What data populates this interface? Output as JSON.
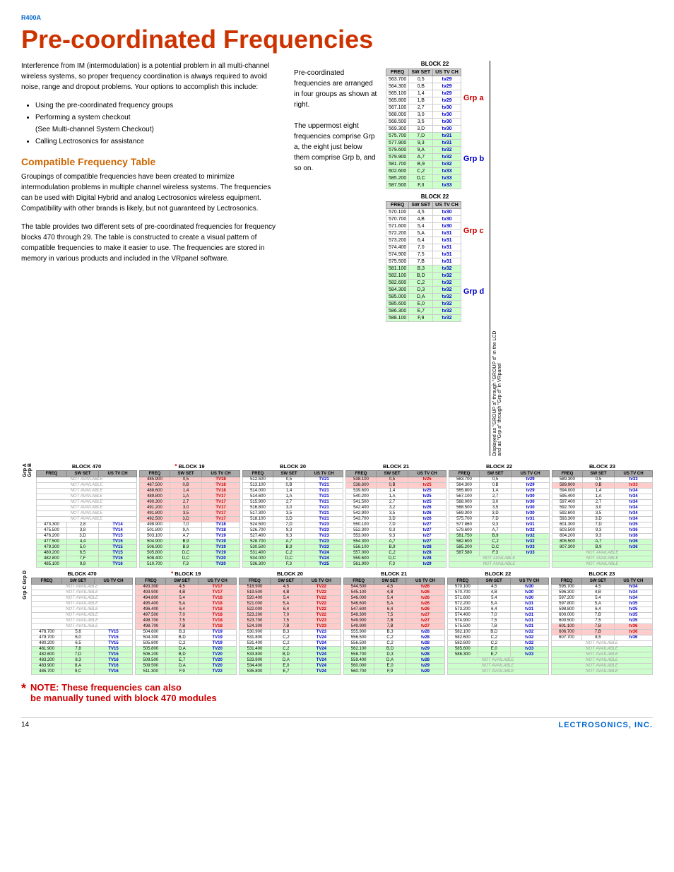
{
  "header": {
    "model": "R400A"
  },
  "title": "Pre-coordinated Frequencies",
  "intro": "Interference from IM (intermodulation) is a potential problem in all multi-channel wireless systems, so proper frequency coordination is always required to avoid noise, range and dropout problems. Your options to accomplish this include:",
  "bullets": [
    "Using the pre-coordinated frequency groups",
    "Performing a system checkout (See Multi-channel System Checkout)",
    "Calling Lectrosonics for assistance"
  ],
  "section_title": "Compatible Frequency Table",
  "body1": "Groupings of compatible frequencies have been created to minimize intermodulation problems in multiple channel wireless systems. The frequencies can be used with Digital Hybrid and analog Lectrosonics wireless equipment. Compatibility with other brands is likely, but not guaranteed by Lectrosonics.",
  "body2": "The table provides two different sets of pre-coordinated frequencies for frequency blocks 470 through 29. The table is constructed to create a visual pattern of compatible frequencies to make it easier to use. The frequencies are stored in memory in various products and included in the VRpanel software.",
  "mid_text1": "Pre-coordinated frequencies are arranged in four groups as shown at right.",
  "mid_text2": "The uppermost eight frequencies comprise Grp a, the eight just below them comprise Grp b, and so on.",
  "note": "NOTE:  These frequencies can also be manually tuned with block 470 modules",
  "footer": {
    "page": "14",
    "brand": "LECTROSONICS, INC."
  },
  "block22_top": {
    "title": "BLOCK 22",
    "headers": [
      "FREQ",
      "SW SET",
      "US TV CH"
    ],
    "rows": [
      [
        "563.700",
        "0,5",
        "tv29"
      ],
      [
        "564.300",
        "0,B",
        "tv29"
      ],
      [
        "565.100",
        "1,4",
        "tv29"
      ],
      [
        "565.800",
        "1,B",
        "tv29"
      ],
      [
        "567.100",
        "2,7",
        "tv30"
      ],
      [
        "568.000",
        "3,0",
        "tv30"
      ],
      [
        "568.500",
        "3,5",
        "tv30"
      ],
      [
        "569.300",
        "3,D",
        "tv30"
      ],
      [
        "575.700",
        "7,D",
        "tv31"
      ],
      [
        "577.900",
        "9,3",
        "tv31"
      ],
      [
        "579.600",
        "9,A",
        "tv32"
      ],
      [
        "579.900",
        "A,7",
        "tv32"
      ],
      [
        "581.700",
        "B,9",
        "tv32"
      ],
      [
        "602.600",
        "C,2",
        "tv33"
      ],
      [
        "585.200",
        "D,C",
        "tv33"
      ],
      [
        "587.500",
        "F,3",
        "tv33"
      ]
    ],
    "grp_a_rows": [
      0,
      7
    ],
    "grp_b_rows": [
      8,
      15
    ]
  },
  "block22_bottom": {
    "title": "BLOCK 22",
    "headers": [
      "FREQ",
      "SW SET",
      "US TV CH"
    ],
    "rows": [
      [
        "570.100",
        "4,5",
        "tv30"
      ],
      [
        "570.700",
        "4,B",
        "tv30"
      ],
      [
        "571.600",
        "5,4",
        "tv30"
      ],
      [
        "572.200",
        "5,A",
        "tv31"
      ],
      [
        "573.200",
        "6,4",
        "tv31"
      ],
      [
        "574.400",
        "7,0",
        "tv31"
      ],
      [
        "574.900",
        "7,5",
        "tv31"
      ],
      [
        "575.500",
        "7,B",
        "tv31"
      ],
      [
        "581.100",
        "B,3",
        "tv32"
      ],
      [
        "582.100",
        "B,D",
        "tv32"
      ],
      [
        "582.600",
        "C,2",
        "tv32"
      ],
      [
        "584.300",
        "D,3",
        "tv32"
      ],
      [
        "585.000",
        "D,A",
        "tv32"
      ],
      [
        "585.600",
        "E,0",
        "tv32"
      ],
      [
        "586.300",
        "E,7",
        "tv32"
      ],
      [
        "588.100",
        "F,9",
        "tv32"
      ]
    ]
  },
  "star_note": "* NOTE:  These frequencies can also be manually tuned with block 470 modules"
}
